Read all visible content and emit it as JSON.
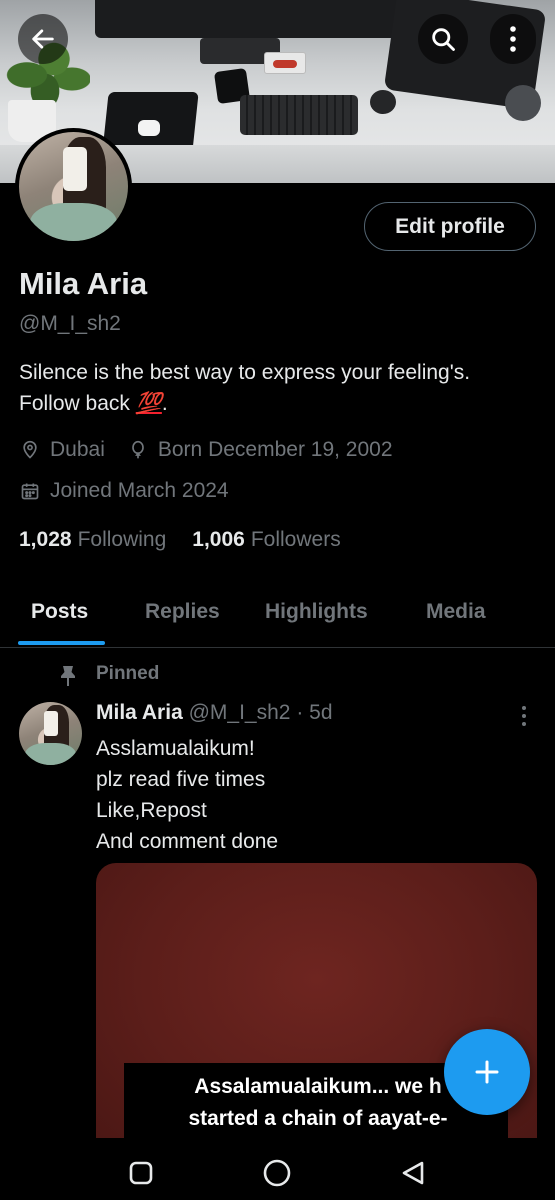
{
  "header": {
    "back_icon": "arrow-left-icon",
    "search_icon": "search-icon",
    "more_icon": "more-vertical-icon"
  },
  "profile": {
    "name": "Mila Aria",
    "handle": "@M_I_sh2",
    "edit_profile_label": "Edit profile",
    "bio_line1": "Silence is the best way to express your feeling's.",
    "bio_line2_prefix": "Follow back ",
    "bio_emoji": "💯",
    "bio_line2_suffix": ".",
    "location": "Dubai",
    "birthday": "Born December 19, 2002",
    "joined": "Joined March 2024",
    "following_count": "1,028",
    "following_label": "Following",
    "followers_count": "1,006",
    "followers_label": "Followers"
  },
  "tabs": [
    {
      "label": "Posts",
      "active": true
    },
    {
      "label": "Replies",
      "active": false
    },
    {
      "label": "Highlights",
      "active": false
    },
    {
      "label": "Media",
      "active": false
    }
  ],
  "post": {
    "pinned_label": "Pinned",
    "author": "Mila Aria",
    "handle": "@M_I_sh2",
    "separator": "·",
    "time": "5d",
    "lines": [
      "Asslamualaikum!",
      "plz read five times",
      "Like,Repost",
      "And comment done"
    ],
    "media_caption_line1": "Assalamualaikum... we h",
    "media_caption_line2": "started a chain of aayat-e-"
  },
  "fab_icon": "plus-icon",
  "colors": {
    "accent": "#1d9bf0",
    "background": "#000000",
    "text_primary": "#e7e9ea",
    "text_secondary": "#71767b",
    "border": "#2f3336"
  },
  "system_nav": {
    "recents_icon": "square-icon",
    "home_icon": "circle-icon",
    "back_icon": "triangle-back-icon"
  }
}
